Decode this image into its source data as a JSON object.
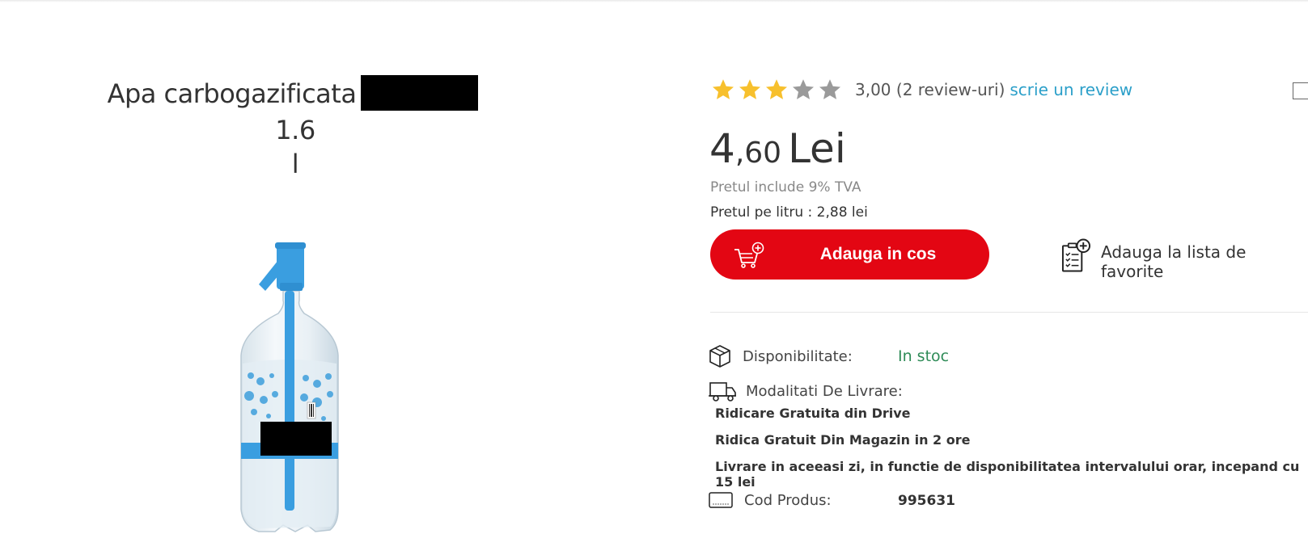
{
  "product": {
    "title_part1": "Apa carbogazificata",
    "title_part2": "1.6",
    "title_part3": "l",
    "image_alt": "Sifon bottle"
  },
  "rating": {
    "stars_filled": 3,
    "stars_total": 5,
    "text": "3,00 (2 review-uri)",
    "link": "scrie un review",
    "star_color": "#f7c02d",
    "star_empty_color": "#9a9a9a",
    "link_color": "#2b9fc9"
  },
  "price": {
    "integer": "4",
    "decimals": ",60",
    "currency": "Lei",
    "vat_note": "Pretul include 9% TVA",
    "per_litre": "Pretul pe litru : 2,88 lei"
  },
  "actions": {
    "add_to_cart": "Adauga in cos",
    "add_to_favorites": "Adauga la lista de favorite",
    "primary_color": "#e30613"
  },
  "details": {
    "availability_label": "Disponibilitate:",
    "availability_value": "In stoc",
    "availability_color": "#2e8b57",
    "delivery_label": "Modalitati De Livrare:",
    "delivery_options": [
      "Ridicare Gratuita din Drive",
      "Ridica Gratuit Din Magazin in 2 ore",
      "Livrare in aceeasi zi, in functie de disponibilitatea intervalului orar, incepand cu 15 lei"
    ],
    "code_label": "Cod Produs:",
    "code_value": "995631"
  },
  "icons": {
    "star": "star-icon",
    "cart": "cart-add-icon",
    "favorites": "list-add-icon",
    "box": "box-icon",
    "truck": "truck-icon",
    "barcode": "barcode-icon",
    "compare": "checkbox-icon"
  }
}
